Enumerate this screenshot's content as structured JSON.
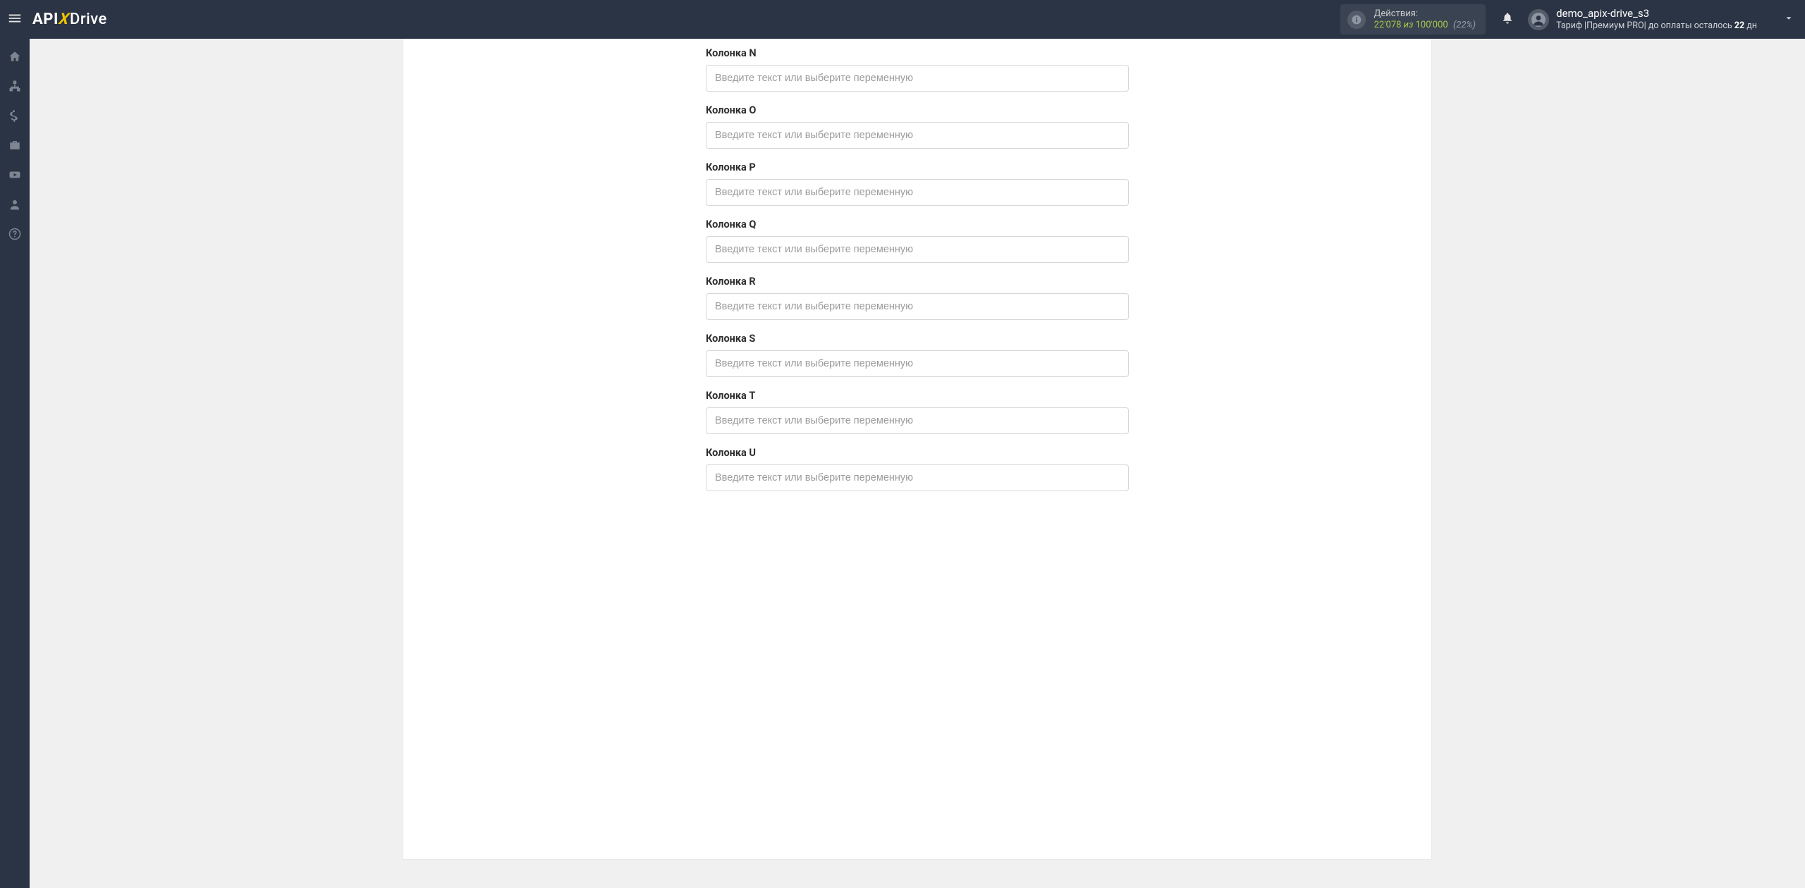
{
  "brand": {
    "part1": "API",
    "part2": "X",
    "part3": "Drive"
  },
  "header": {
    "actions": {
      "label": "Действия:",
      "used": "22'078",
      "sep": "из",
      "total": "100'000",
      "pct": "(22%)"
    },
    "user": {
      "name": "demo_apix-drive_s3",
      "tariff_prefix": "Тариф |Премиум PRO| до оплаты осталось ",
      "days": "22",
      "tariff_suffix": " дн"
    }
  },
  "sidebar_icons": [
    "home-icon",
    "sitemap-icon",
    "dollar-icon",
    "briefcase-icon",
    "youtube-icon",
    "user-icon",
    "help-icon"
  ],
  "form": {
    "placeholder": "Введите текст или выберите переменную",
    "fields": [
      {
        "key": "n",
        "label": "Колонка N"
      },
      {
        "key": "o",
        "label": "Колонка O"
      },
      {
        "key": "p",
        "label": "Колонка P"
      },
      {
        "key": "q",
        "label": "Колонка Q"
      },
      {
        "key": "r",
        "label": "Колонка R"
      },
      {
        "key": "s",
        "label": "Колонка S"
      },
      {
        "key": "t",
        "label": "Колонка T"
      },
      {
        "key": "u",
        "label": "Колонка U"
      }
    ]
  }
}
